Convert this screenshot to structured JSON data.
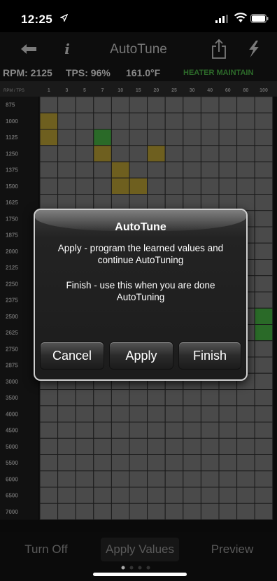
{
  "status_bar": {
    "time": "12:25"
  },
  "nav": {
    "title": "AutoTune",
    "back_icon": "back-arrow-icon",
    "info_icon": "info-icon",
    "share_icon": "share-icon",
    "flash_icon": "flash-icon"
  },
  "info_line": {
    "rpm": "RPM: 2125",
    "tps": "TPS: 96%",
    "temp": "161.0°F",
    "heater": "HEATER MAINTAIN"
  },
  "grid": {
    "corner_label": "RPM / TPS",
    "tps_columns": [
      "1",
      "3",
      "5",
      "7",
      "10",
      "15",
      "20",
      "25",
      "30",
      "40",
      "60",
      "80",
      "100"
    ],
    "rpm_rows": [
      "875",
      "1000",
      "1125",
      "1250",
      "1375",
      "1500",
      "1625",
      "1750",
      "1875",
      "2000",
      "2125",
      "2250",
      "2375",
      "2500",
      "2625",
      "2750",
      "2875",
      "3000",
      "3500",
      "4000",
      "4500",
      "5000",
      "5500",
      "6000",
      "6500",
      "7000"
    ],
    "colors": {
      "cell": "#4a4a4a",
      "line": "#1a1a1a",
      "yellow": "#6e5f1f",
      "green": "#2a6a28",
      "header_bg": "#1a1a1a",
      "label": "#6a6a6a"
    },
    "highlighted_cells": [
      {
        "row": 1,
        "col": 0,
        "color": "yellow"
      },
      {
        "row": 2,
        "col": 0,
        "color": "yellow"
      },
      {
        "row": 2,
        "col": 3,
        "color": "green"
      },
      {
        "row": 3,
        "col": 3,
        "color": "yellow"
      },
      {
        "row": 3,
        "col": 6,
        "color": "yellow"
      },
      {
        "row": 4,
        "col": 4,
        "color": "yellow"
      },
      {
        "row": 5,
        "col": 4,
        "color": "yellow"
      },
      {
        "row": 5,
        "col": 5,
        "color": "yellow"
      },
      {
        "row": 13,
        "col": 12,
        "color": "green"
      },
      {
        "row": 14,
        "col": 12,
        "color": "green"
      }
    ]
  },
  "alert": {
    "title": "AutoTune",
    "message_apply": "Apply - program the learned values and continue AutoTuning",
    "message_finish": "Finish - use this when you are done AutoTuning",
    "buttons": {
      "cancel": "Cancel",
      "apply": "Apply",
      "finish": "Finish"
    }
  },
  "bottom_bar": {
    "turn_off": "Turn Off",
    "apply_values": "Apply Values",
    "preview": "Preview"
  }
}
